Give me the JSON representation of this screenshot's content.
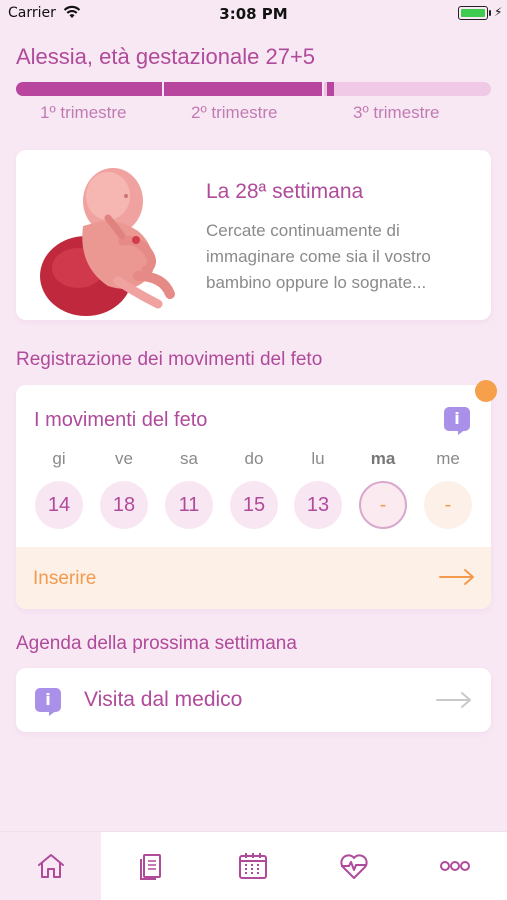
{
  "status_bar": {
    "carrier": "Carrier",
    "time": "3:08 PM",
    "battery_charging_glyph": "⚡"
  },
  "header": {
    "title": "Alessia, età gestazionale 27+5",
    "progress_fraction": 0.67,
    "trimesters": [
      "1º trimestre",
      "2º trimestre",
      "3º trimestre"
    ]
  },
  "week_card": {
    "title": "La 28ª settimana",
    "description": "Cercate continuamente di immaginare come sia il vostro bambino oppure lo sognate..."
  },
  "movements_section": {
    "label": "Registrazione dei movimenti del feto",
    "card_title": "I movimenti del feto",
    "info_icon_glyph": "i",
    "days": [
      {
        "name": "gi",
        "value": "14",
        "state": "past"
      },
      {
        "name": "ve",
        "value": "18",
        "state": "past"
      },
      {
        "name": "sa",
        "value": "11",
        "state": "past"
      },
      {
        "name": "do",
        "value": "15",
        "state": "past"
      },
      {
        "name": "lu",
        "value": "13",
        "state": "past"
      },
      {
        "name": "ma",
        "value": "-",
        "state": "today"
      },
      {
        "name": "me",
        "value": "-",
        "state": "future"
      }
    ],
    "insert_label": "Inserire"
  },
  "agenda_section": {
    "label": "Agenda della prossima settimana",
    "item_label": "Visita dal medico",
    "info_icon_glyph": "i"
  },
  "tabbar": {
    "tabs": [
      "home-icon",
      "documents-icon",
      "calendar-icon",
      "heart-rate-icon",
      "more-icon"
    ],
    "active_index": 0
  },
  "colors": {
    "brand": "#b04a9a",
    "accent": "#f39a4e",
    "info": "#a990e8",
    "background": "#f8e8f4"
  }
}
